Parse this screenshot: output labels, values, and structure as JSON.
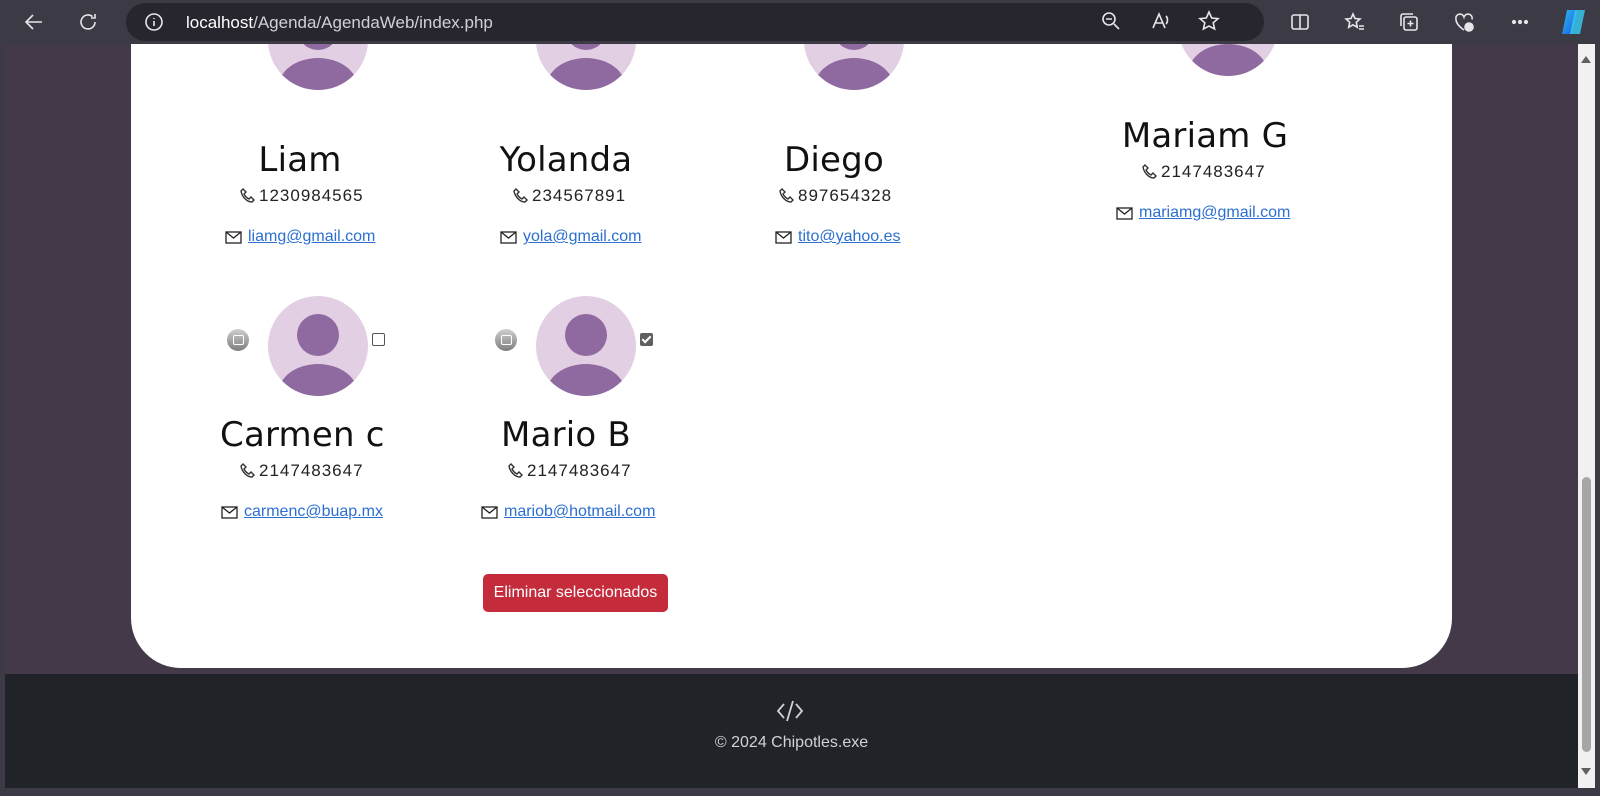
{
  "browser": {
    "url_host": "localhost",
    "url_path": "/Agenda/AgendaWeb/index.php",
    "icons": [
      "back-icon",
      "refresh-icon",
      "info-icon",
      "zoom-out-icon",
      "read-aloud-icon",
      "favorite-star-icon",
      "split-screen-icon",
      "favorites-icon",
      "collections-icon",
      "browser-essentials-icon",
      "more-icon",
      "copilot-icon"
    ]
  },
  "contacts": [
    {
      "name": "Liam",
      "phone": "1230984565",
      "email": "liamg@gmail.com"
    },
    {
      "name": "Yolanda",
      "phone": "234567891",
      "email": "yola@gmail.com"
    },
    {
      "name": "Diego",
      "phone": "897654328",
      "email": "tito@yahoo.es"
    },
    {
      "name": "Mariam G",
      "phone": " 2147483647",
      "email": "mariamg@gmail.com"
    },
    {
      "name": "Carmen c",
      "phone": "2147483647",
      "email": "carmenc@buap.mx",
      "selected": false
    },
    {
      "name": "Mario B",
      "phone": "2147483647",
      "email": "mariob@hotmail.com",
      "selected": true
    }
  ],
  "actions": {
    "delete_selected": "Eliminar seleccionados"
  },
  "footer": {
    "copyright": "© 2024 Chipotles.exe"
  },
  "colors": {
    "avatar_bg": "#e3cfe3",
    "avatar_fg": "#8f6aa0",
    "danger": "#c42b3b",
    "link": "#2b6fd1",
    "page_bg": "#433949",
    "footer_bg": "#202327"
  }
}
